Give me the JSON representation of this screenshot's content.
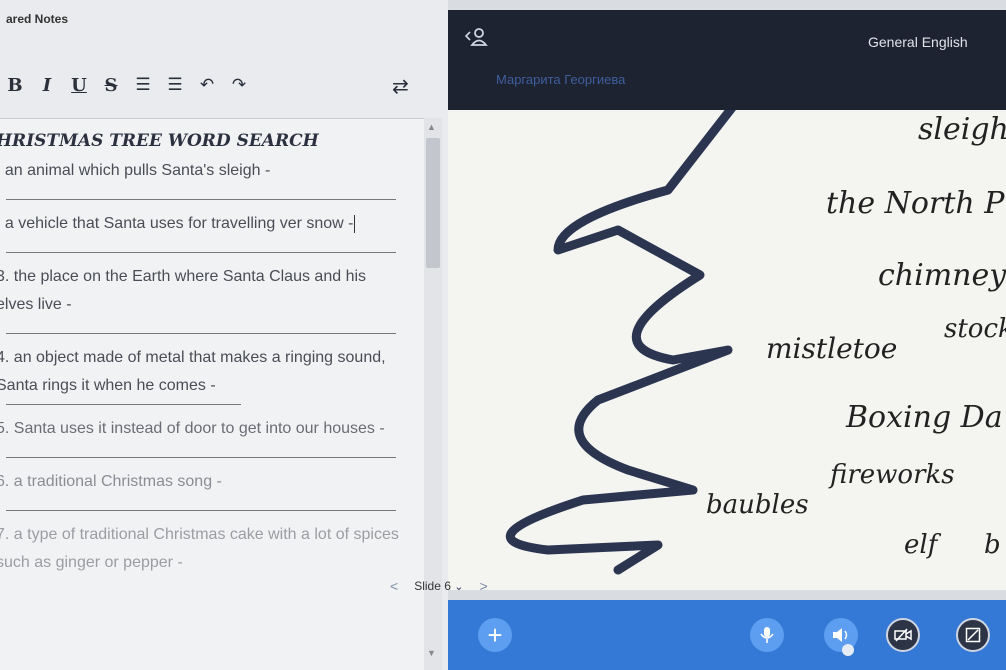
{
  "notes": {
    "title": "ared Notes",
    "toolbar": {
      "bold": "B",
      "italic": "I",
      "underline": "U",
      "strike": "S",
      "ordered_list": "☰",
      "bullet_list": "☰",
      "undo": "↶",
      "redo": "↷",
      "swap": "⇄"
    },
    "doc": {
      "title": "HRISTMAS TREE WORD SEARCH",
      "questions": [
        ". an animal which pulls Santa's sleigh -",
        ". a vehicle that Santa uses for travelling ver snow -",
        "3. the place on the Earth where Santa Claus and his elves live -",
        "4. an object made of metal that makes a ringing sound, Santa rings it when he comes -",
        "5. Santa uses it instead of door to get into our houses -",
        "6. a traditional Christmas song -",
        "7. a type of traditional Christmas cake with a lot of spices such as ginger or pepper -"
      ]
    }
  },
  "header": {
    "presenter_name": "Маргарита Георгиева",
    "session_title": "General English"
  },
  "slide": {
    "words": [
      "sleigh",
      "the North P",
      "chimney",
      "stock",
      "mistletoe",
      "Boxing Da",
      "fireworks",
      "baubles",
      "elf",
      "b"
    ]
  },
  "slide_nav": {
    "prev": "<",
    "label": "Slide 6",
    "dropdown": "⌄",
    "next": ">"
  },
  "bottom": {
    "plus": "+"
  },
  "colors": {
    "topbar": "#1d2331",
    "bottombar": "#3479d6",
    "accent": "#5d9ef0"
  }
}
